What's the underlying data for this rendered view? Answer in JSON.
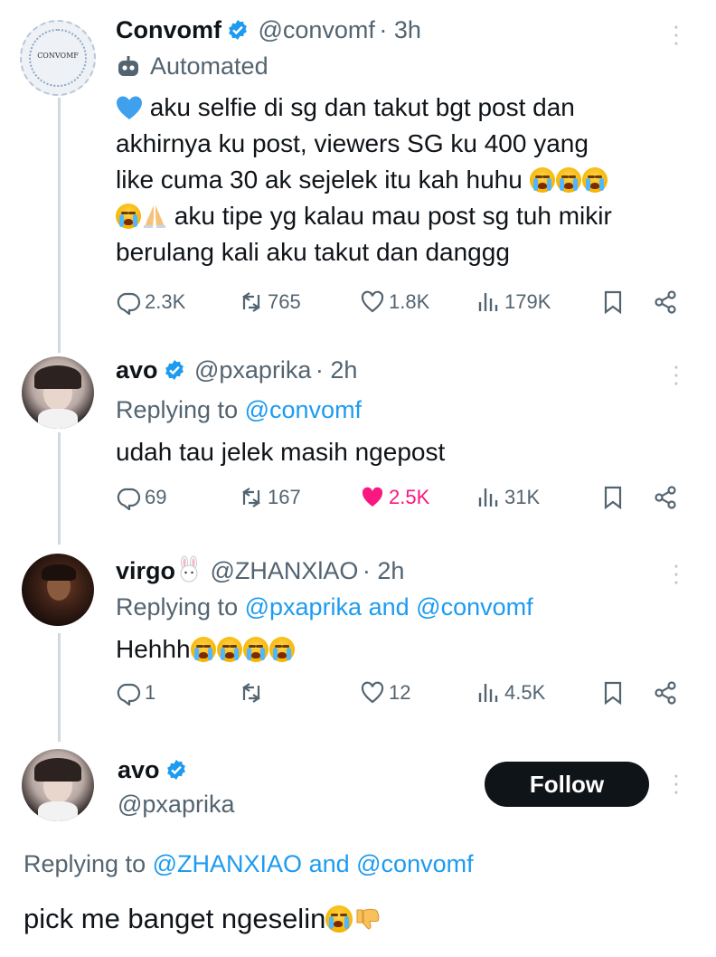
{
  "tweets": [
    {
      "name": "Convomf",
      "handle": "@convomf",
      "time": "· 3h",
      "automated_label": "Automated",
      "avatar_text": "CONVOMF",
      "text_lines": [
        "aku selfie di sg dan takut bgt post dan",
        "akhirnya ku post, viewers SG ku 400 yang",
        "like cuma 30 ak sejelek itu kah huhu",
        "aku tipe yg kalau mau post sg tuh mikir",
        "berulang kali aku takut dan danggg"
      ],
      "stats": {
        "replies": "2.3K",
        "retweets": "765",
        "likes": "1.8K",
        "views": "179K"
      }
    },
    {
      "name": "avo",
      "handle": "@pxaprika",
      "time": "· 2h",
      "replying_prefix": "Replying to",
      "replying_to": "@convomf",
      "text": "udah tau jelek masih ngepost",
      "stats": {
        "replies": "69",
        "retweets": "167",
        "likes": "2.5K",
        "views": "31K"
      }
    },
    {
      "name": "virgo",
      "handle": "@ZHANXlAO",
      "time": "· 2h",
      "replying_prefix": "Replying to",
      "replying_to_1": "@pxaprika",
      "replying_and": "and",
      "replying_to_2": "@convomf",
      "text": "Hehhh",
      "stats": {
        "replies": "1",
        "retweets": "",
        "likes": "12",
        "views": "4.5K"
      }
    },
    {
      "name": "avo",
      "handle": "@pxaprika",
      "follow_label": "Follow",
      "replying_prefix": "Replying to",
      "replying_to_1": "@ZHANXIAO",
      "replying_and": "and",
      "replying_to_2": "@convomf",
      "text": "pick me banget ngeselin"
    }
  ],
  "colors": {
    "accent": "#1d9bf0",
    "like_active": "#f91880",
    "secondary_text": "#536471",
    "follow_bg": "#0f1419"
  },
  "icons": [
    "verified-badge-icon",
    "bot-icon",
    "more-icon",
    "reply-icon",
    "retweet-icon",
    "like-icon",
    "views-icon",
    "bookmark-icon",
    "share-icon",
    "blue-heart-emoji",
    "crying-emoji",
    "praying-hands-emoji",
    "rabbit-emoji",
    "thumbs-down-emoji"
  ]
}
